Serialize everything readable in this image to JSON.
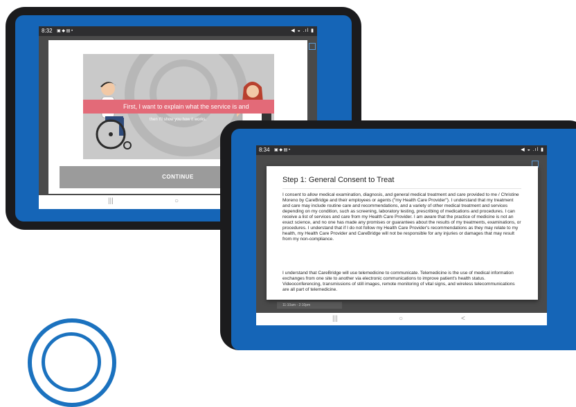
{
  "tablet1": {
    "status_time": "8:32",
    "status_icons_left": "▣ ◆ ▤ •",
    "status_icons_right": "◀ ◒ .ıl ▮",
    "caption": "First, I want to explain what the service is and",
    "sub_caption": "then I'll show you how it works.",
    "continue_label": "CONTINUE",
    "nav": {
      "recent": "|||",
      "home": "○",
      "back": "<"
    }
  },
  "tablet2": {
    "status_time": "8:34",
    "status_icons_left": "▣ ◆ ▤ •",
    "status_icons_right": "◀ ◒ .ıl ▮",
    "modal_title": "Step 1: General Consent to Treat",
    "paragraph1": "I consent to allow medical examination, diagnosis, and general medical treatment and care provided to me / Christine  Moreno by CareBridge and their employees or agents (\"my Health Care Provider\"). I understand that my treatment and care may include routine care and recommendations, and a variety of other medical treatment and services depending on my condition, such as screening, laboratory testing, prescribing of medications and procedures. I can receive a list of services and care from my Health Care Provider. I am aware that the practice of medicine is not an exact science, and no one has made any promises or guarantees about the results of my treatments, examinations, or procedures. I understand that if I do not follow my Health Care Provider's recommendations as they may relate to my health, my Health Care Provider and CareBridge will not be responsible for any injuries or damages that may result from my non-compliance.",
    "paragraph2": "I understand that CareBridge will use telemedicine to communicate. Telemedicine is the use of medical information exchanges from one site to another via electronic communications to improve patient's health status. Videoconferencing, transmissions of still images, remote monitoring of vital signs, and wireless telecommunications are all part of telemedicine.",
    "bg_time_slot": "11:10am - 2:10pm",
    "nav": {
      "recent": "|||",
      "home": "○",
      "back": "<"
    }
  },
  "colors": {
    "brand_blue": "#1565b7",
    "caption_pink": "#e36a78",
    "bezel_black": "#1b1b1d"
  }
}
